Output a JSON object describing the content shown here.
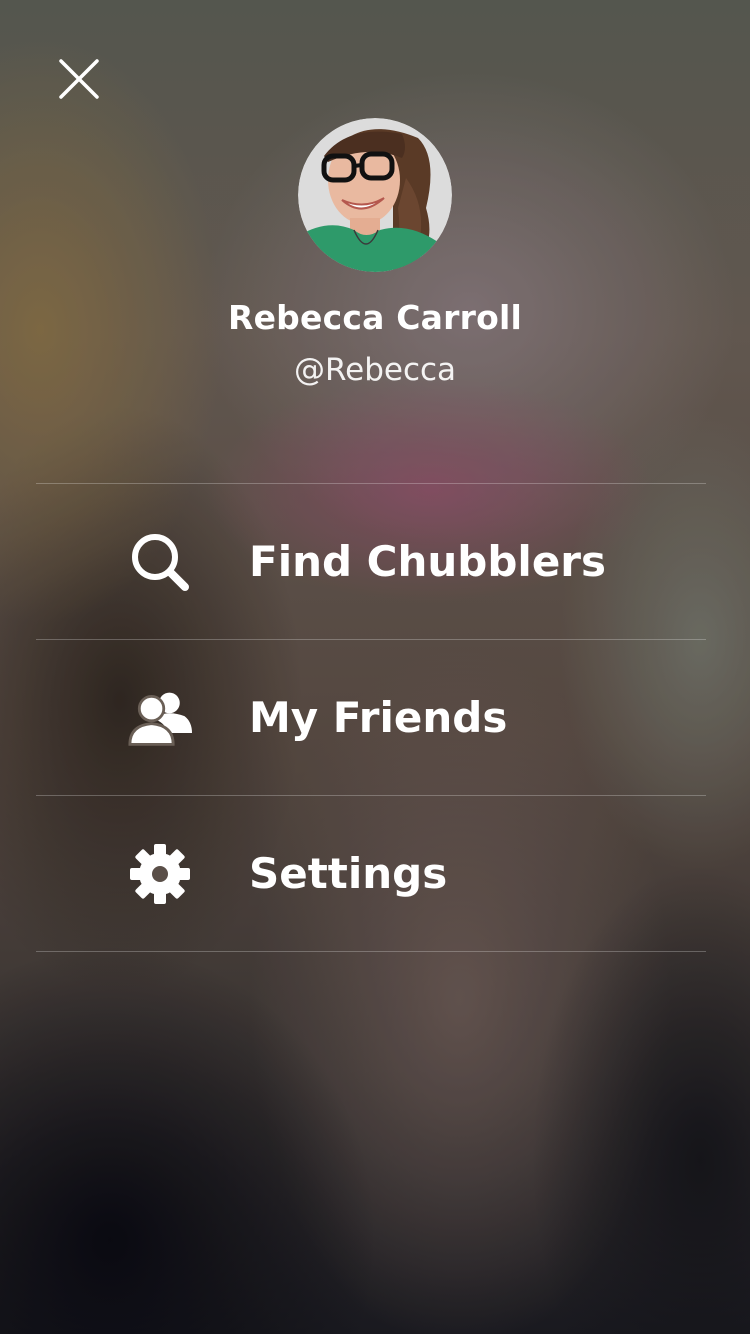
{
  "profile": {
    "name": "Rebecca Carroll",
    "handle": "@Rebecca"
  },
  "menu": {
    "items": [
      {
        "label": "Find Chubblers",
        "icon": "search-icon"
      },
      {
        "label": "My Friends",
        "icon": "friends-icon"
      },
      {
        "label": "Settings",
        "icon": "gear-icon"
      }
    ]
  },
  "icons": {
    "close": "close-icon"
  },
  "colors": {
    "text": "#ffffff",
    "divider": "rgba(255,255,255,0.25)"
  }
}
